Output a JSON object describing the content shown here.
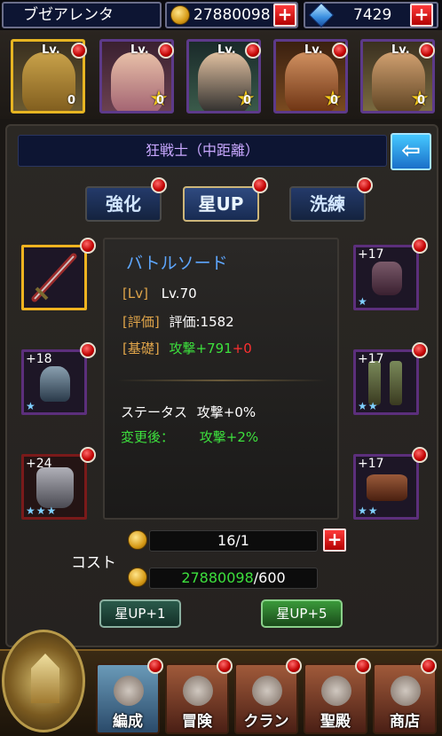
{
  "top": {
    "player_name": "ブゼアレンタ",
    "gold": "27880098",
    "gems": "7429"
  },
  "heroes": [
    {
      "lv": "Lv.",
      "count": "0",
      "selected": true
    },
    {
      "lv": "Lv.",
      "count": "0",
      "selected": false
    },
    {
      "lv": "Lv.",
      "count": "0",
      "selected": false
    },
    {
      "lv": "Lv.",
      "count": "0",
      "selected": false
    },
    {
      "lv": "Lv.",
      "count": "0",
      "selected": false
    }
  ],
  "class_label": "狂戦士（中距離）",
  "tabs": {
    "enhance": "強化",
    "starup": "星UP",
    "refine": "洗練"
  },
  "item": {
    "name": "バトルソード",
    "lv_label": "[Lv]",
    "lv_value": "Lv.70",
    "rating_label": "[評価]",
    "rating_value": "評価:1582",
    "base_label": "[基礎]",
    "base_value": "攻撃+791",
    "base_bonus": "+0",
    "status_label": "ステータス",
    "status_value": "攻撃+0%",
    "after_label": "変更後：",
    "after_value": "攻撃+2%"
  },
  "slots": {
    "left": [
      {
        "plus": "",
        "stars": ""
      },
      {
        "plus": "+18",
        "stars": "★"
      },
      {
        "plus": "+24",
        "stars": "★★★"
      }
    ],
    "right": [
      {
        "plus": "+17",
        "stars": "★"
      },
      {
        "plus": "+17",
        "stars": "★★"
      },
      {
        "plus": "+17",
        "stars": "★★"
      }
    ]
  },
  "cost": {
    "label": "コスト",
    "material": "16/1",
    "gold_have": "27880098",
    "gold_need": "/600"
  },
  "actions": {
    "starup1": "星UP+1",
    "starup5": "星UP+5"
  },
  "nav": {
    "formation": "編成",
    "adventure": "冒険",
    "clan": "クラン",
    "shrine": "聖殿",
    "shop": "商店"
  }
}
